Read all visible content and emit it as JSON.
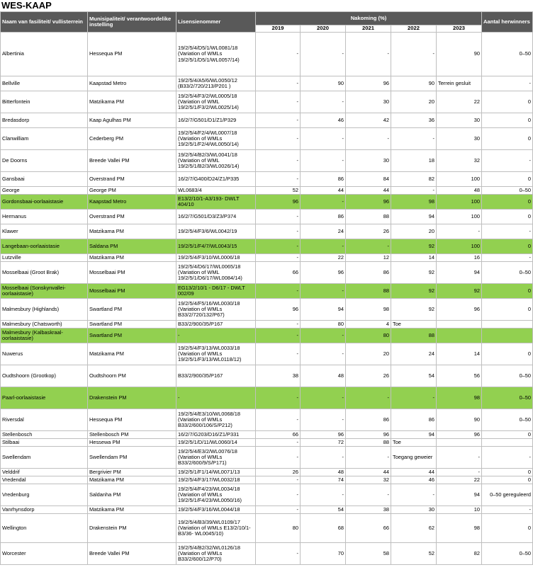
{
  "page": {
    "title": "WES-KAAP"
  },
  "headers": {
    "name": "Naam van fasiliteit/ vullisterrein",
    "municipality": "Munisipaliteit/ verantwoordelike instelling",
    "license": "Lisensienommer",
    "compliance": "Nakoming (%)",
    "years": [
      "2019",
      "2020",
      "2021",
      "2022",
      "2023"
    ],
    "recyclers": "Aantal herwinners"
  },
  "rows": [
    {
      "name": "Albertinia",
      "muni": "Hessequa PM",
      "lic": "19/2/5/4/D5/1/WL0081/18 (Variation of WMLs 19/2/5/1/D5/1/WL0057/14)",
      "y2019": "-",
      "y2020": "-",
      "y2021": "-",
      "y2022": "-",
      "y2023": "90",
      "cap": "0–50",
      "h": 62,
      "green": false
    },
    {
      "name": "Bellville",
      "muni": "Kaapstad Metro",
      "lic": "19/2/5/4/A5/6/WL0050/12 (B33/2/720/213/P201 )",
      "y2019": "-",
      "y2020": "90",
      "y2021": "96",
      "y2022": "90",
      "y2023": "Terrein gesluit",
      "cap": "-",
      "h": 21,
      "green": false
    },
    {
      "name": "Bitterfontein",
      "muni": "Matzikama PM",
      "lic": "19/2/5/4/F3/2/WL0005/18 (Variation of WML 19/2/5/1/F3/2/WL0025/14)",
      "y2019": "-",
      "y2020": "-",
      "y2021": "30",
      "y2022": "20",
      "y2023": "22",
      "cap": "0",
      "h": 31,
      "green": false
    },
    {
      "name": "Bredasdorp",
      "muni": "Kaap Agulhas PM",
      "lic": "16/2/7/G501/D1/Z1/P329",
      "y2019": "-",
      "y2020": "46",
      "y2021": "42",
      "y2022": "36",
      "y2023": "30",
      "cap": "0",
      "h": 21,
      "green": false
    },
    {
      "name": "Clanwilliam",
      "muni": "Cederberg PM",
      "lic": "19/2/5/4/F2/4/WL0007/18 (Variation of WMLs 19/2/5/1/F2/4/WL0050/14)",
      "y2019": "-",
      "y2020": "-",
      "y2021": "-",
      "y2022": "-",
      "y2023": "30",
      "cap": "0",
      "h": 31,
      "green": false
    },
    {
      "name": "De Doorns",
      "muni": "Breede Vallei PM",
      "lic": "19/2/5/4/B2/3/WL0041/18 (Variation of WML 19/2/5/1/B2/3/WL0026/14)",
      "y2019": "-",
      "y2020": "-",
      "y2021": "30",
      "y2022": "18",
      "y2023": "32",
      "cap": "-",
      "h": 31,
      "green": false
    },
    {
      "name": "Gansbaai",
      "muni": "Overstrand PM",
      "lic": "16/2/7/G400/D24/Z1/P335",
      "y2019": "-",
      "y2020": "86",
      "y2021": "84",
      "y2022": "82",
      "y2023": "100",
      "cap": "0",
      "h": 21,
      "green": false
    },
    {
      "name": "George",
      "muni": "George PM",
      "lic": "WL0683/4",
      "y2019": "52",
      "y2020": "44",
      "y2021": "44",
      "y2022": "-",
      "y2023": "48",
      "cap": "0–50",
      "h": 11,
      "green": false
    },
    {
      "name": "Gordonsbaai-oorlaaistasie",
      "muni": "Kaapstad Metro",
      "lic": "E13/2/10/1-A3/193- DWLT 404/10",
      "y2019": "96",
      "y2020": "-",
      "y2021": "96",
      "y2022": "98",
      "y2023": "100",
      "cap": "0",
      "h": 21,
      "green": true
    },
    {
      "name": "Hermanus",
      "muni": "Overstrand PM",
      "lic": "16/2/7/G501/D3/Z3/P374",
      "y2019": "-",
      "y2020": "86",
      "y2021": "88",
      "y2022": "94",
      "y2023": "100",
      "cap": "0",
      "h": 21,
      "green": false
    },
    {
      "name": "Klawer",
      "muni": "Matzikama PM",
      "lic": "19/2/5/4/F3/6/WL0042/19",
      "y2019": "-",
      "y2020": "24",
      "y2021": "26",
      "y2022": "20",
      "y2023": "-",
      "cap": "-",
      "h": 21,
      "green": false
    },
    {
      "name": "Langebaan-oorlaaistasie",
      "muni": "Saldana PM",
      "lic": "19/2/5/1/F4/7/WL0043/15",
      "y2019": "-",
      "y2020": "-",
      "y2021": "-",
      "y2022": "92",
      "y2023": "100",
      "cap": "0",
      "h": 21,
      "green": true
    },
    {
      "name": "Lutzville",
      "muni": "Matzikama PM",
      "lic": "19/2/5/4/F3/10/WL0006/18",
      "y2019": "-",
      "y2020": "22",
      "y2021": "12",
      "y2022": "14",
      "y2023": "16",
      "cap": "-",
      "h": 11,
      "green": false
    },
    {
      "name": "Mosselbaai (Groot Brak)",
      "muni": "Mosselbaai PM",
      "lic": "19/2/5/4/D6/17/WL0065/18 (Variation of WML 19/2/5/1/D6/17/WL0084/14)",
      "y2019": "66",
      "y2020": "96",
      "y2021": "86",
      "y2022": "92",
      "y2023": "94",
      "cap": "0–50",
      "h": 31,
      "green": false
    },
    {
      "name": "Mosselbaai (Sonskynvallei-oorlaaistasie)",
      "muni": "Mosselbaai PM",
      "lic": "EG13/2/10/1 - D6/17 - DWLT 002/09",
      "y2019": "-",
      "y2020": "-",
      "y2021": "88",
      "y2022": "92",
      "y2023": "92",
      "cap": "0",
      "h": 21,
      "green": true
    },
    {
      "name": "Malmesbury (Highlands)",
      "muni": "Swartland PM",
      "lic": "19/2/5/4/F5/16/WL0030/18 (Variation of WMLs B33/2/720/132/P67)",
      "y2019": "96",
      "y2020": "94",
      "y2021": "98",
      "y2022": "92",
      "y2023": "96",
      "cap": "0",
      "h": 31,
      "green": false
    },
    {
      "name": "Malmesbury (Chatsworth)",
      "muni": "Swartland PM",
      "lic": "B33/2/900/35/P167",
      "y2019": "-",
      "y2020": "80",
      "y2021": "4",
      "y2022": "Toe",
      "y2023": "",
      "cap": "",
      "h": 11,
      "green": false
    },
    {
      "name": "Malmesbury (Kalbaskraal-oorlaaistasie)",
      "muni": "Swartland PM",
      "lic": "-",
      "y2019": "-",
      "y2020": "-",
      "y2021": "80",
      "y2022": "88",
      "y2023": "",
      "cap": "",
      "h": 21,
      "green": true
    },
    {
      "name": "Nuwerus",
      "muni": "Matzikama PM",
      "lic": "19/2/5/4/F3/13/WL0033/18 (Variation of WMLs 19/2/5/1/F3/13/WL0118/12)",
      "y2019": "-",
      "y2020": "-",
      "y2021": "20",
      "y2022": "24",
      "y2023": "14",
      "cap": "0",
      "h": 31,
      "green": false
    },
    {
      "name": "Oudtshoorn (Grootkop)",
      "muni": "Oudtshoorn PM",
      "lic": "B33/2/900/35/P167",
      "y2019": "38",
      "y2020": "48",
      "y2021": "26",
      "y2022": "54",
      "y2023": "56",
      "cap": "0–50",
      "h": 31,
      "green": false
    },
    {
      "name": "Paarl-oorlaaistasie",
      "muni": "Drakenstein PM",
      "lic": "-",
      "y2019": "-",
      "y2020": "-",
      "y2021": "-",
      "y2022": "-",
      "y2023": "98",
      "cap": "0–50",
      "h": 31,
      "green": true
    },
    {
      "name": "Riversdal",
      "muni": "Hessequa PM",
      "lic": "19/2/5/4/E3/10/WL0068/18 (Variation of WMLs B33/2/600/106/S/P212)",
      "y2019": "-",
      "y2020": "-",
      "y2021": "86",
      "y2022": "86",
      "y2023": "90",
      "cap": "0–50",
      "h": 31,
      "green": false
    },
    {
      "name": "Stellenbosch",
      "muni": "Stellenbosch PM",
      "lic": "16/2/7/G203/D16/Z1/P331",
      "y2019": "66",
      "y2020": "96",
      "y2021": "96",
      "y2022": "94",
      "y2023": "96",
      "cap": "0",
      "h": 11,
      "green": false
    },
    {
      "name": "Stilbaai",
      "muni": "Hessewa PM",
      "lic": "19/2/5/1/D/11/WL0060/14",
      "y2019": "-",
      "y2020": "72",
      "y2021": "88",
      "y2022": "Toe",
      "y2023": "",
      "cap": "",
      "h": 11,
      "green": false
    },
    {
      "name": "Swellendam",
      "muni": "Swellendam PM",
      "lic": "19/2/5/4/E3/2/WL0076/18 (Variation of WMLs B33/2/600/9/S/P171)",
      "y2019": "-",
      "y2020": "-",
      "y2021": "-",
      "y2022": "Toegang geweier",
      "y2023": "-",
      "cap": "-",
      "h": 31,
      "green": false
    },
    {
      "name": "Velddrif",
      "muni": "Bergrivier PM",
      "lic": "19/2/5/1/F1/14/WL0071/13",
      "y2019": "26",
      "y2020": "48",
      "y2021": "44",
      "y2022": "44",
      "y2023": "-",
      "cap": "0",
      "h": 11,
      "green": false
    },
    {
      "name": "Vredendal",
      "muni": "Matzikama PM",
      "lic": "19/2/5/4/F3/17/WL0032/18",
      "y2019": "-",
      "y2020": "74",
      "y2021": "32",
      "y2022": "46",
      "y2023": "22",
      "cap": "0",
      "h": 11,
      "green": false
    },
    {
      "name": "Vredenburg",
      "muni": "Saldanha PM",
      "lic": "19/2/5/4/F4/23/WL0034/18 (Variation of WMLs 19/2/5/1/F4/23/WL0050/16)",
      "y2019": "-",
      "y2020": "-",
      "y2021": "-",
      "y2022": "-",
      "y2023": "94",
      "cap": "0–50 gereguleerd",
      "h": 31,
      "green": false
    },
    {
      "name": "Vanrhynsdorp",
      "muni": "Matzikama PM",
      "lic": "19/2/5/4/F3/16/WL0044/18",
      "y2019": "-",
      "y2020": "54",
      "y2021": "38",
      "y2022": "30",
      "y2023": "10",
      "cap": "-",
      "h": 11,
      "green": false
    },
    {
      "name": "Wellington",
      "muni": "Drakenstein PM",
      "lic": "19/2/5/4/B3/39/WL0109/17 (Variation of WMLs E13/2/10/1-B3/36- WL0045/10)",
      "y2019": "80",
      "y2020": "68",
      "y2021": "66",
      "y2022": "62",
      "y2023": "98",
      "cap": "0",
      "h": 41,
      "green": false
    },
    {
      "name": "Worcester",
      "muni": "Breede Vallei PM",
      "lic": "19/2/5/4/B2/32/WL0126/18 (Variation of WMLs B33/2/600/12/P70)",
      "y2019": "-",
      "y2020": "70",
      "y2021": "58",
      "y2022": "52",
      "y2023": "82",
      "cap": "0–50",
      "h": 31,
      "green": false
    }
  ]
}
